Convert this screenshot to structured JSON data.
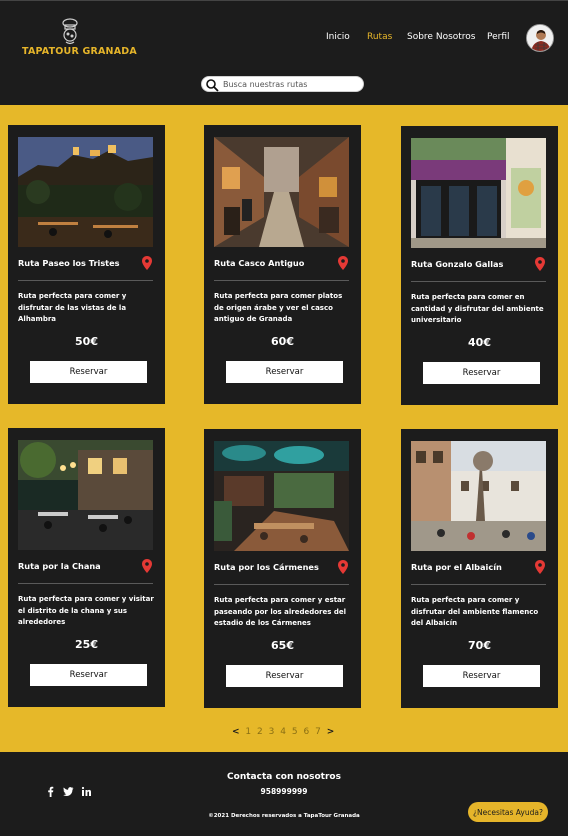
{
  "header": {
    "brand": "TAPATOUR GRANADA",
    "nav": [
      {
        "label": "Inicio",
        "active": false
      },
      {
        "label": "Rutas",
        "active": true
      },
      {
        "label": "Sobre Nosotros",
        "active": false
      },
      {
        "label": "Perfil",
        "active": false
      }
    ],
    "search_placeholder": "Busca nuestras rutas",
    "search_value": ""
  },
  "routes": [
    {
      "title": "Ruta Paseo los Tristes",
      "description": "Ruta perfecta para comer y disfrutar de las vistas de la Alhambra",
      "price": "50€",
      "button": "Reservar",
      "image": "alhambra-night"
    },
    {
      "title": "Ruta Casco Antiguo",
      "description": "Ruta perfecta para comer platos de origen árabe y ver el casco antiguo de Granada",
      "price": "60€",
      "button": "Reservar",
      "image": "old-town-street"
    },
    {
      "title": "Ruta Gonzalo Gallas",
      "description": "Ruta perfecta para comer en cantidad y disfrutar del ambiente universitario",
      "price": "40€",
      "button": "Reservar",
      "image": "bar-facade"
    },
    {
      "title": "Ruta por la Chana",
      "description": "Ruta perfecta para comer y visitar el distrito de la chana y sus alrededores",
      "price": "25€",
      "button": "Reservar",
      "image": "terrace-night"
    },
    {
      "title": "Ruta por los Cármenes",
      "description": "Ruta perfecta para comer y estar paseando por los alrededores del estadio de los Cármenes",
      "price": "65€",
      "button": "Reservar",
      "image": "restaurant-interior"
    },
    {
      "title": "Ruta por el Albaicín",
      "description": "Ruta perfecta para comer y disfrutar del ambiente flamenco del Albaicín",
      "price": "70€",
      "button": "Reservar",
      "image": "albaicin-square"
    }
  ],
  "pagination": {
    "prev": "<",
    "next": ">",
    "pages": [
      "1",
      "2",
      "3",
      "4",
      "5",
      "6",
      "7"
    ]
  },
  "footer": {
    "contact_title": "Contacta con nosotros",
    "phone": "958999999",
    "copyright": "©2021 Derechos reservados a TapaTour Granada",
    "social": [
      "facebook-icon",
      "twitter-icon",
      "linkedin-icon"
    ],
    "help_button": "¿Necesitas Ayuda?"
  },
  "colors": {
    "accent": "#e6b829",
    "dark": "#1c1c1c",
    "pin": "#e53935"
  }
}
